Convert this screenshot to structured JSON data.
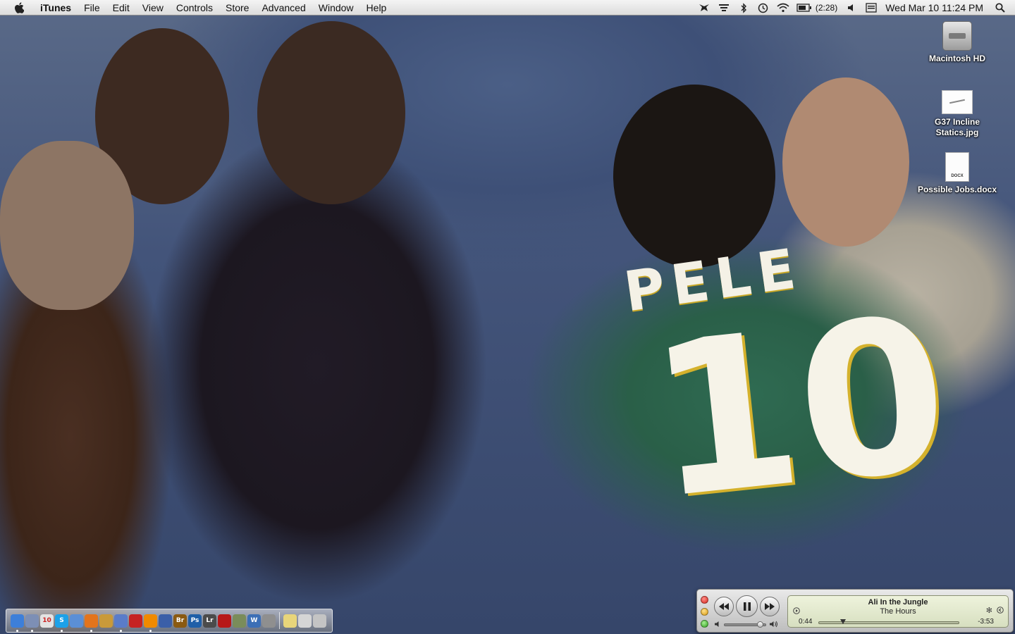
{
  "menubar": {
    "apple_icon": "apple-logo-icon",
    "items": [
      "iTunes",
      "File",
      "Edit",
      "View",
      "Controls",
      "Store",
      "Advanced",
      "Window",
      "Help"
    ],
    "status": {
      "battery_time": "(2:28)",
      "clock": "Wed Mar 10  11:24 PM"
    }
  },
  "wallpaper": {
    "jersey_name": "PELE",
    "jersey_number": "10"
  },
  "desktop_icons": [
    {
      "icon": "hard-drive-icon",
      "lines": [
        "Macintosh HD"
      ]
    },
    {
      "icon": "jpg-file-icon",
      "lines": [
        "G37 Incline",
        "Statics.jpg"
      ]
    },
    {
      "icon": "docx-file-icon",
      "lines": [
        "Possible Jobs.docx"
      ],
      "badge": "DOCX"
    }
  ],
  "dock": {
    "apps": [
      {
        "name": "finder-icon",
        "color": "#3d7fd9",
        "glyph": ""
      },
      {
        "name": "preview-icon",
        "color": "#7d8fb5",
        "glyph": ""
      },
      {
        "name": "ical-icon",
        "color": "#e3e3e3",
        "glyph": "10"
      },
      {
        "name": "skype-icon",
        "color": "#1da1e8",
        "glyph": "S"
      },
      {
        "name": "ichat-icon",
        "color": "#5b8fd6",
        "glyph": ""
      },
      {
        "name": "firefox-icon",
        "color": "#e3741c",
        "glyph": ""
      },
      {
        "name": "garageband-icon",
        "color": "#c99a3a",
        "glyph": ""
      },
      {
        "name": "itunes-icon",
        "color": "#5a7cc9",
        "glyph": ""
      },
      {
        "name": "photo-booth-icon",
        "color": "#c62222",
        "glyph": ""
      },
      {
        "name": "vlc-icon",
        "color": "#f08a00",
        "glyph": ""
      },
      {
        "name": "network-icon",
        "color": "#3b5fa8",
        "glyph": ""
      },
      {
        "name": "bridge-icon",
        "color": "#8a5a12",
        "glyph": "Br"
      },
      {
        "name": "photoshop-icon",
        "color": "#1f5fa8",
        "glyph": "Ps"
      },
      {
        "name": "lightroom-icon",
        "color": "#4b4b4b",
        "glyph": "Lr"
      },
      {
        "name": "acrobat-icon",
        "color": "#b71818",
        "glyph": ""
      },
      {
        "name": "iphoto-icon",
        "color": "#7a8c5a",
        "glyph": ""
      },
      {
        "name": "word-icon",
        "color": "#3c6fb6",
        "glyph": "W"
      },
      {
        "name": "system-preferences-icon",
        "color": "#8f8f8f",
        "glyph": ""
      }
    ],
    "extras": [
      {
        "name": "documents-stack-icon",
        "color": "#e8d57a"
      },
      {
        "name": "applications-stack-icon",
        "color": "#d5d5d5"
      },
      {
        "name": "trash-icon",
        "color": "#c4c4c4"
      }
    ]
  },
  "player": {
    "track_title": "Ali In the Jungle",
    "track_artist": "The Hours",
    "elapsed": "0:44",
    "remaining": "-3:53",
    "progress_fraction": 0.17,
    "volume_fraction": 0.85
  }
}
